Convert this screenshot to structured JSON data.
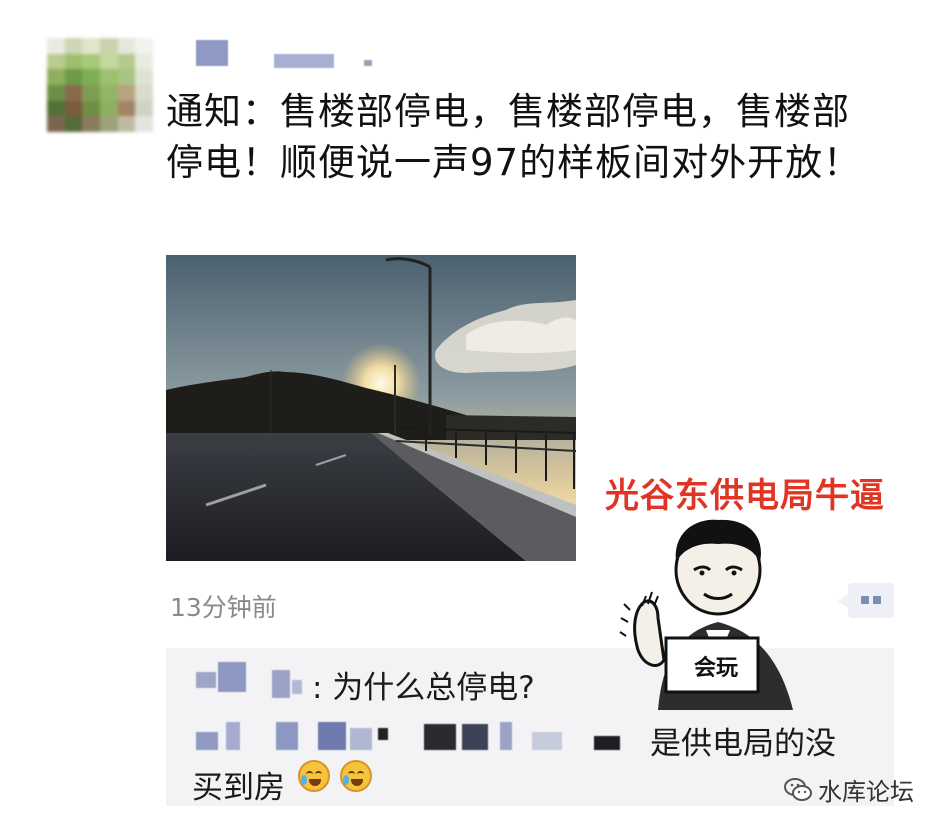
{
  "post": {
    "text": "通知：售楼部停电，售楼部停电，售楼部停电！顺便说一声97的样板间对外开放！",
    "timestamp": "13分钟前"
  },
  "comments": [
    {
      "text": ": 为什么总停电?"
    },
    {
      "text": "是供电局的没"
    },
    {
      "text": "买到房"
    }
  ],
  "overlay": {
    "title": "光谷东供电局牛逼",
    "meme_caption": "会玩"
  },
  "watermark": {
    "text": "水库论坛"
  },
  "icons": {
    "comment": "comment-icon",
    "emoji": "laugh-cry-emoji-icon",
    "watermark": "wechat-icon"
  },
  "colors": {
    "accent_red": "#e03424",
    "comment_bg": "#f3f3f5",
    "timestamp": "#8a8a8a"
  }
}
